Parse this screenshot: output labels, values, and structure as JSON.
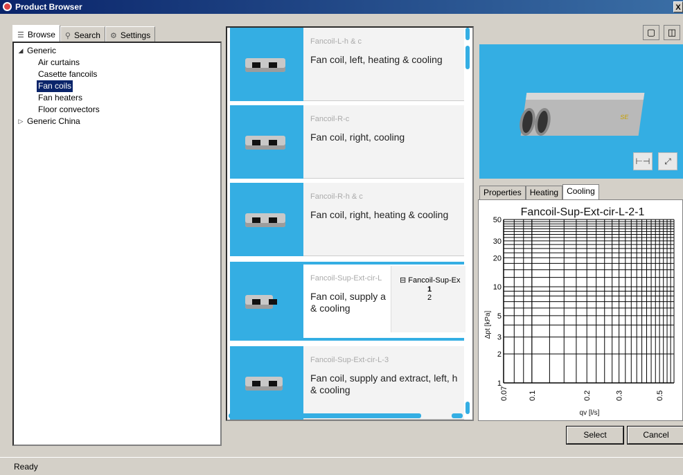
{
  "window": {
    "title": "Product Browser",
    "close": "X"
  },
  "tabs": [
    {
      "label": "Browse",
      "icon": "tree-icon"
    },
    {
      "label": "Search",
      "icon": "search-icon"
    },
    {
      "label": "Settings",
      "icon": "gear-icon"
    }
  ],
  "tree": {
    "generic": "Generic",
    "children": [
      "Air curtains",
      "Casette fancoils",
      "Fan coils",
      "Fan heaters",
      "Floor convectors"
    ],
    "selected": "Fan coils",
    "generic_china": "Generic China"
  },
  "products": [
    {
      "code": "Fancoil-L-h & c",
      "desc": "Fan coil, left, heating & cooling"
    },
    {
      "code": "Fancoil-R-c",
      "desc": "Fan coil, right, cooling"
    },
    {
      "code": "Fancoil-R-h & c",
      "desc": "Fan coil, right, heating & cooling"
    },
    {
      "code": "Fancoil-Sup-Ext-cir-L",
      "desc": "Fan coil, supply a & cooling"
    },
    {
      "code": "Fancoil-Sup-Ext-cir-L-3",
      "desc": "Fan coil, supply and extract, left, h & cooling"
    }
  ],
  "popup": {
    "header": "Fancoil-Sup-Ex",
    "values": [
      "1",
      "2"
    ]
  },
  "preview": {
    "unit_logo": "SE"
  },
  "property_tabs": [
    "Properties",
    "Heating",
    "Cooling"
  ],
  "active_property_tab": "Cooling",
  "chart_data": {
    "type": "line",
    "title": "Fancoil-Sup-Ext-cir-L-2-1",
    "xlabel": "qv [l/s]",
    "ylabel": "Δpt [kPa]",
    "xscale": "log",
    "yscale": "log",
    "xlim": [
      0.07,
      0.6
    ],
    "ylim": [
      1,
      50
    ],
    "x_ticks": [
      "0.07",
      "0.1",
      "0.2",
      "0.3",
      "0.5"
    ],
    "y_ticks": [
      "1",
      "2",
      "3",
      "5",
      "10",
      "20",
      "30",
      "50"
    ],
    "grid": true,
    "series": []
  },
  "actions": {
    "select": "Select",
    "cancel": "Cancel"
  },
  "status": "Ready"
}
